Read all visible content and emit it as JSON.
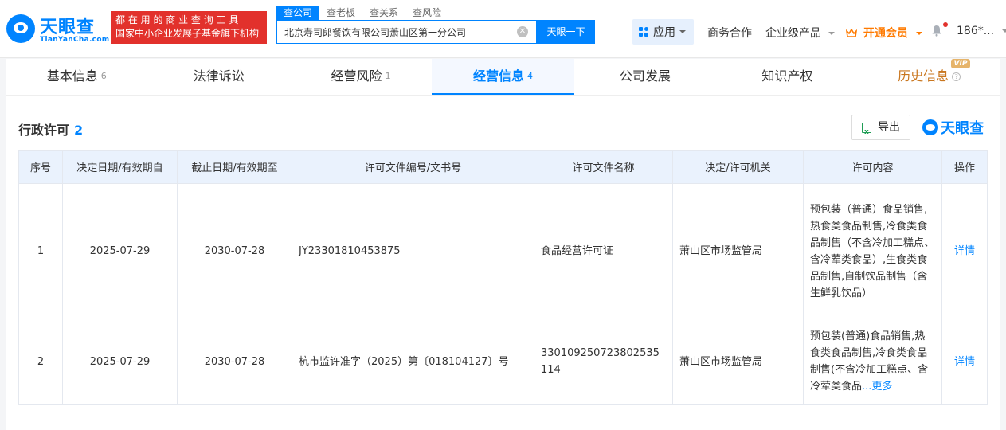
{
  "brand": {
    "name": "天眼查",
    "sub": "TianYanCha.com",
    "slogan_line1": "都 在 用 的 商 业 查 询 工 具",
    "slogan_line2": "国家中小企业发展子基金旗下机构"
  },
  "search": {
    "tabs": [
      "查公司",
      "查老板",
      "查关系",
      "查风险"
    ],
    "value": "北京寿司郎餐饮有限公司萧山区第一分公司",
    "button": "天眼一下"
  },
  "nav": {
    "app": "应用",
    "business": "商务合作",
    "enterprise": "企业级产品",
    "vip": "开通会员",
    "user": "186*..."
  },
  "tabs": [
    {
      "label": "基本信息",
      "count": "6"
    },
    {
      "label": "法律诉讼",
      "count": ""
    },
    {
      "label": "经营风险",
      "count": "1"
    },
    {
      "label": "经营信息",
      "count": "4"
    },
    {
      "label": "公司发展",
      "count": ""
    },
    {
      "label": "知识产权",
      "count": ""
    },
    {
      "label": "历史信息",
      "count": "",
      "badge": "VIP"
    }
  ],
  "section": {
    "title": "行政许可",
    "count": "2",
    "export": "导出",
    "watermark": "天眼查"
  },
  "table": {
    "headers": [
      "序号",
      "决定日期/有效期自",
      "截止日期/有效期至",
      "许可文件编号/文书号",
      "许可文件名称",
      "决定/许可机关",
      "许可内容",
      "操作"
    ],
    "rows": [
      {
        "no": "1",
        "start": "2025-07-29",
        "end": "2030-07-28",
        "doc_no": "JY23301810453875",
        "doc_name": "食品经营许可证",
        "authority": "萧山区市场监管局",
        "content": "预包装（普通）食品销售,热食类食品制售,冷食类食品制售（不含冷加工糕点、含冷荤类食品）,生食类食品制售,自制饮品制售（含生鲜乳饮品）",
        "action": "详情"
      },
      {
        "no": "2",
        "start": "2025-07-29",
        "end": "2030-07-28",
        "doc_no": "杭市监许准字（2025）第〔018104127〕号",
        "doc_name": "330109250723802535114",
        "authority": "萧山区市场监管局",
        "content": "预包装(普通)食品销售,热食类食品制售,冷食类食品制售(不含冷加工糕点、含冷荤类食品",
        "more": "...更多",
        "action": "详情"
      }
    ]
  },
  "colors": {
    "primary": "#0084ff",
    "slogan_bg": "#e2312c",
    "vip": "#ff7a00",
    "history": "#c9761e",
    "header_bg": "#eaf2fd"
  }
}
